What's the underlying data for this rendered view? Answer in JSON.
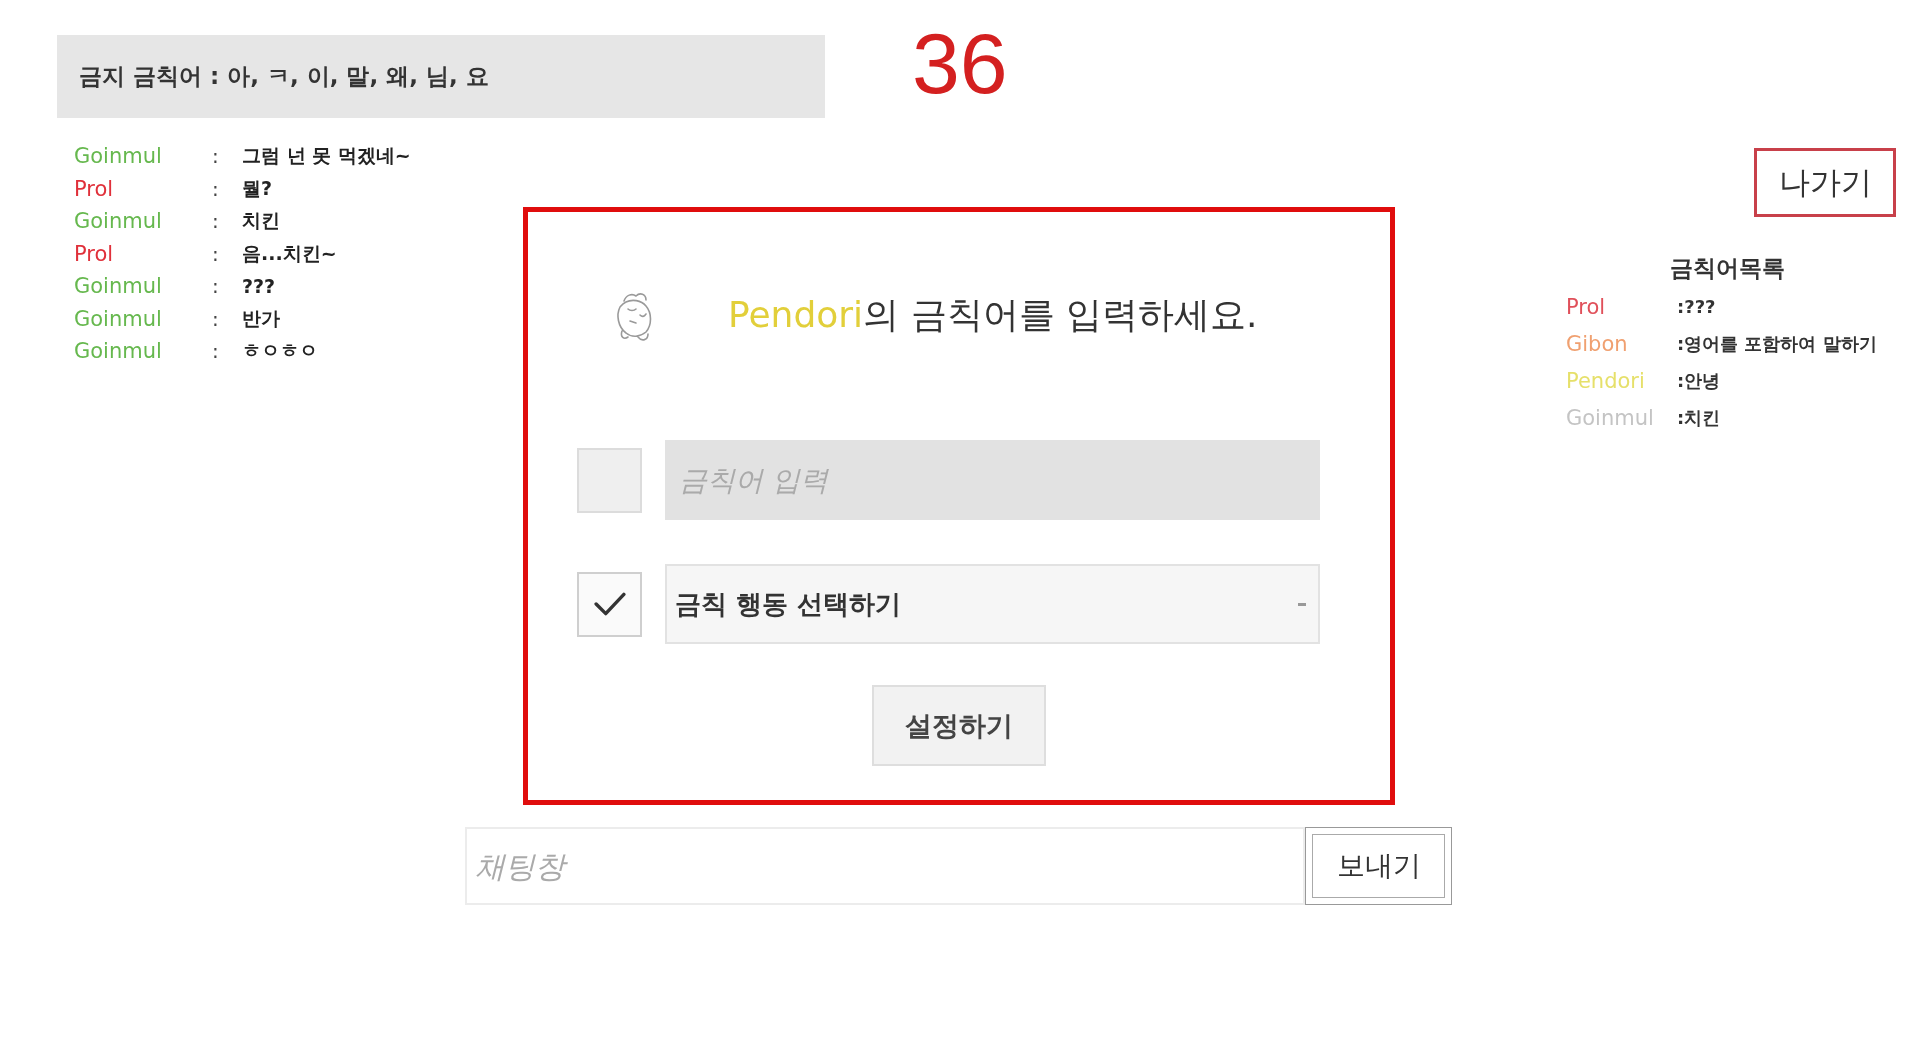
{
  "banner": {
    "text": "금지 금칙어 : 아, ㅋ, 이, 말, 왜, 님, 요"
  },
  "counter": "36",
  "chat_log": [
    {
      "name": "Goinmul",
      "color": "#66b84e",
      "separator": ":",
      "message": "그럼 넌 못 먹겠네~"
    },
    {
      "name": "Prol",
      "color": "#e0303a",
      "separator": ":",
      "message": "뭘?"
    },
    {
      "name": "Goinmul",
      "color": "#66b84e",
      "separator": ":",
      "message": "치킨"
    },
    {
      "name": "Prol",
      "color": "#e0303a",
      "separator": ":",
      "message": "음...치킨~"
    },
    {
      "name": "Goinmul",
      "color": "#66b84e",
      "separator": ":",
      "message": "???"
    },
    {
      "name": "Goinmul",
      "color": "#66b84e",
      "separator": ":",
      "message": "반가"
    },
    {
      "name": "Goinmul",
      "color": "#66b84e",
      "separator": ":",
      "message": "ㅎㅇㅎㅇ"
    }
  ],
  "exit_button": "나가기",
  "dialog": {
    "title": {
      "player": "Pendori",
      "text": "의 금칙어를 입력하세요."
    },
    "rows": [
      {
        "kind": "input",
        "checked": false,
        "placeholder": "금칙어 입력"
      },
      {
        "kind": "select",
        "checked": true,
        "value": "금칙 행동 선택하기"
      }
    ],
    "button": "설정하기"
  },
  "word_list": {
    "title": "금칙어목록",
    "items": [
      {
        "name": "Prol",
        "color": "#e0505a",
        "word": ":???"
      },
      {
        "name": "Gibon",
        "color": "#f0a070",
        "word": ":영어를 포함하여 말하기"
      },
      {
        "name": "Pendori",
        "color": "#e6e06a",
        "word": ":안녕"
      },
      {
        "name": "Goinmul",
        "color": "#c4c4c4",
        "word": ":치킨"
      }
    ]
  },
  "chat_input": {
    "placeholder": "채팅창",
    "send_button": "보내기"
  }
}
